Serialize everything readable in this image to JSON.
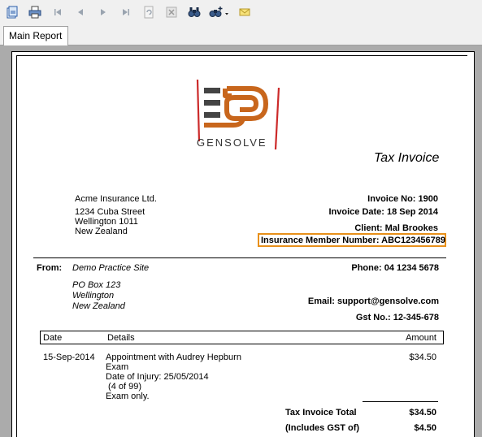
{
  "toolbar": {
    "buttons": [
      {
        "name": "export-icon"
      },
      {
        "name": "print-icon"
      },
      {
        "name": "first-page-icon"
      },
      {
        "name": "prev-page-icon"
      },
      {
        "name": "next-page-icon"
      },
      {
        "name": "last-page-icon"
      },
      {
        "name": "refresh-icon"
      },
      {
        "name": "stop-icon"
      },
      {
        "name": "search-icon"
      },
      {
        "name": "zoom-icon"
      },
      {
        "name": "email-icon"
      }
    ]
  },
  "tabs": [
    {
      "label": "Main Report"
    }
  ],
  "report": {
    "logo_text": "GENSOLVE",
    "title": "Tax Invoice",
    "recipient": {
      "line1": "Acme Insurance Ltd.",
      "line2": "1234 Cuba Street",
      "line3": "Wellington 1011",
      "line4": "New Zealand"
    },
    "invoice_no": "Invoice No: 1900",
    "invoice_date": "Invoice Date: 18 Sep 2014",
    "client": "Client: Mal Brookes",
    "insurance_member": "Insurance Member Number: ABC123456789",
    "from_label": "From:",
    "from_name": "Demo Practice Site",
    "from_addr1": "PO Box 123",
    "from_addr2": "Wellington",
    "from_addr3": "New Zealand",
    "phone": "Phone: 04 1234 5678",
    "email": "Email: support@gensolve.com",
    "gst_no": "Gst No.: 12-345-678",
    "table": {
      "col_date": "Date",
      "col_details": "Details",
      "col_amount": "Amount",
      "rows": [
        {
          "date": "15-Sep-2014",
          "details": [
            "Appointment with Audrey Hepburn",
            "Exam",
            "Date of Injury: 25/05/2014",
            " (4 of 99)",
            "Exam only."
          ],
          "amount": "$34.50"
        }
      ]
    },
    "total_label": "Tax Invoice Total",
    "total_value": "$34.50",
    "gst_label": "(Includes GST of)",
    "gst_value": "$4.50"
  },
  "colors": {
    "highlight": "#e8901a",
    "logo_orange": "#c8661c",
    "logo_red": "#cc2a2a"
  }
}
